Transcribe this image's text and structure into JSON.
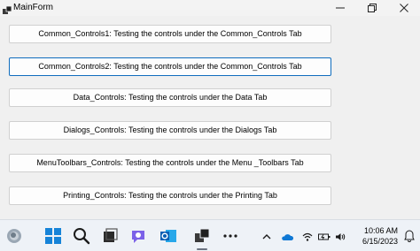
{
  "window": {
    "title": "MainForm"
  },
  "buttons": [
    {
      "label": "Common_Controls1: Testing the controls under the Common_Controls Tab"
    },
    {
      "label": "Common_Controls2: Testing the controls under the Common_Controls Tab"
    },
    {
      "label": "Data_Controls: Testing the controls under the Data Tab"
    },
    {
      "label": "Dialogs_Controls: Testing the controls under the Dialogs Tab"
    },
    {
      "label": "MenuToolbars_Controls: Testing the controls under the Menu _Toolbars Tab"
    },
    {
      "label": "Printing_Controls: Testing the controls under the Printing Tab"
    }
  ],
  "focused_button": "Common_Controls2: Testing the controls under the Common_Controls Tab",
  "taskbar": {
    "time": "10:06 AM",
    "date": "6/15/2023",
    "icons": [
      "widgets-icon",
      "start-icon",
      "search-icon",
      "task-view-icon",
      "chat-icon",
      "outlook-icon",
      "mainform-app-icon",
      "more-icon"
    ],
    "tray": [
      "chevron-up-icon",
      "onedrive-icon",
      "wifi-icon",
      "battery-icon",
      "volume-icon"
    ]
  },
  "colors": {
    "focus_border": "#0f6cbd",
    "taskbar_bg": "#eef2f7",
    "client_bg": "#f0f0f0"
  }
}
